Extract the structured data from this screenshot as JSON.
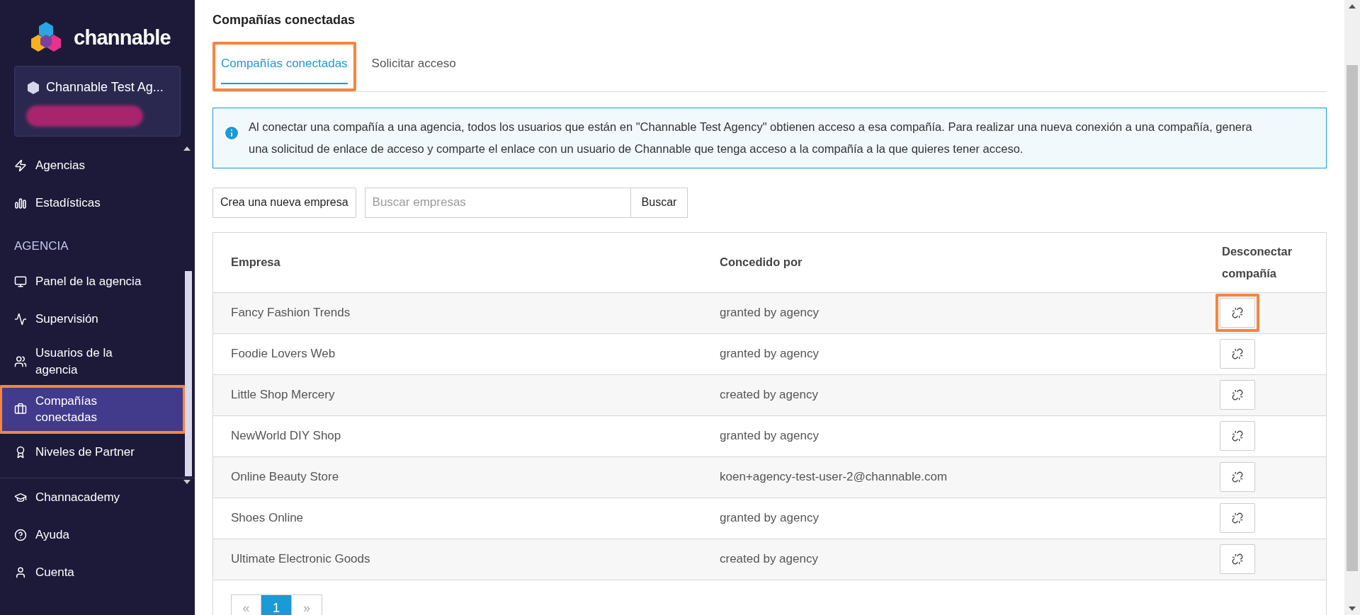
{
  "brand": {
    "name": "channable"
  },
  "account": {
    "name": "Channable Test Ag..."
  },
  "nav": [
    {
      "kind": "item",
      "label": "Agencias",
      "selected": false,
      "highlighted": false
    },
    {
      "kind": "item",
      "label": "Estadísticas",
      "selected": false,
      "highlighted": false
    },
    {
      "kind": "section",
      "label": "AGENCIA"
    },
    {
      "kind": "item",
      "label": "Panel de la agencia",
      "selected": false,
      "highlighted": false
    },
    {
      "kind": "item",
      "label": "Supervisión",
      "selected": false,
      "highlighted": false
    },
    {
      "kind": "item",
      "label": "Usuarios de la agencia",
      "selected": false,
      "highlighted": false
    },
    {
      "kind": "item",
      "label": "Compañías conectadas",
      "selected": true,
      "highlighted": true
    },
    {
      "kind": "item",
      "label": "Niveles de Partner",
      "selected": false,
      "highlighted": false
    }
  ],
  "nav_bottom": [
    {
      "label": "Channacademy"
    },
    {
      "label": "Ayuda"
    },
    {
      "label": "Cuenta"
    }
  ],
  "page": {
    "title": "Compañías conectadas"
  },
  "tabs": [
    {
      "label": "Compañías conectadas",
      "selected": true,
      "highlighted": true
    },
    {
      "label": "Solicitar acceso",
      "selected": false,
      "highlighted": false
    }
  ],
  "info": {
    "text": "Al conectar una compañía a una agencia, todos los usuarios que están en \"Channable Test Agency\" obtienen acceso a esa compañía. Para realizar una nueva conexión a una compañía, genera una solicitud de enlace de acceso y comparte el enlace con un usuario de Channable que tenga acceso a la compañía a la que quieres tener acceso."
  },
  "toolbar": {
    "create_button": "Crea una nueva empresa",
    "search_placeholder": "Buscar empresas",
    "search_button": "Buscar"
  },
  "table": {
    "columns": [
      "Empresa",
      "Concedido por",
      "Desconectar compañía"
    ],
    "rows": [
      {
        "company": "Fancy Fashion Trends",
        "granted_by": "granted by agency",
        "highlighted": true
      },
      {
        "company": "Foodie Lovers Web",
        "granted_by": "granted by agency",
        "highlighted": false
      },
      {
        "company": "Little Shop Mercery",
        "granted_by": "created by agency",
        "highlighted": false
      },
      {
        "company": "NewWorld DIY Shop",
        "granted_by": "granted by agency",
        "highlighted": false
      },
      {
        "company": "Online Beauty Store",
        "granted_by": "koen+agency-test-user-2@channable.com",
        "highlighted": false
      },
      {
        "company": "Shoes Online",
        "granted_by": "granted by agency",
        "highlighted": false
      },
      {
        "company": "Ultimate Electronic Goods",
        "granted_by": "created by agency",
        "highlighted": false
      }
    ]
  },
  "pagination": [
    {
      "label": "«",
      "selected": false
    },
    {
      "label": "1",
      "selected": true
    },
    {
      "label": "»",
      "selected": false
    }
  ]
}
